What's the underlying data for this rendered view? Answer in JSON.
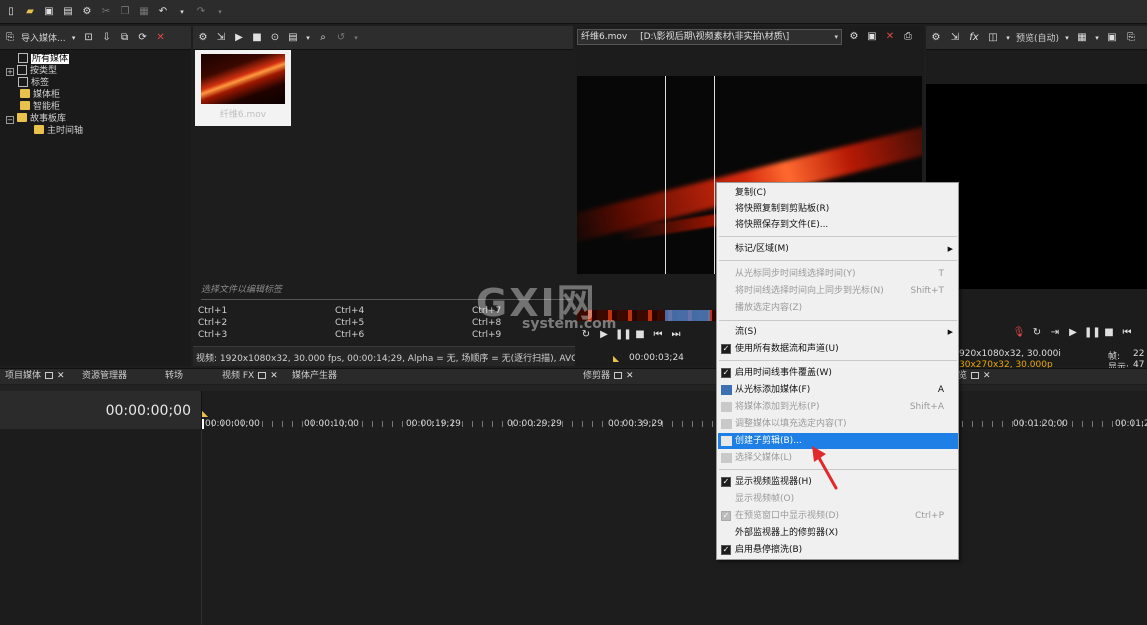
{
  "project_tree": {
    "items": [
      {
        "label": "所有媒体"
      },
      {
        "label": "按类型"
      },
      {
        "label": "标签"
      },
      {
        "label": "媒体柜"
      },
      {
        "label": "智能柜"
      },
      {
        "label": "故事板库"
      },
      {
        "label": "主时间轴"
      }
    ]
  },
  "media_toolbar": {
    "import_label": "导入媒体..."
  },
  "media": {
    "thumb_label": "纤维6.mov",
    "tag_hint": "选择文件以编辑标签",
    "shortcuts": [
      "Ctrl+1",
      "Ctrl+2",
      "Ctrl+3",
      "Ctrl+4",
      "Ctrl+5",
      "Ctrl+6",
      "Ctrl+7",
      "Ctrl+8",
      "Ctrl+9"
    ],
    "info": "视频: 1920x1080x32, 30.000 fps, 00:00:14;29, Alpha = 无, 场顺序 = 无(逐行扫描), AVC"
  },
  "trimmer": {
    "file": "纤维6.mov",
    "path": "[D:\\影视后期\\视频素材\\非实拍\\材质\\]",
    "timecode": "00:00:03;24"
  },
  "preview": {
    "mode": "预览(自动)",
    "info1": "920x1080x32, 30.000i",
    "info2": "30x270x32, 30.000p",
    "frame_label": "帧:",
    "frame_value": "22",
    "display_label": "显示:",
    "display_value": "47"
  },
  "tabs": {
    "project_media": "项目媒体",
    "explorer": "资源管理器",
    "transitions": "转场",
    "video_fx": "视频 FX",
    "media_generators": "媒体产生器",
    "trimmer": "修剪器",
    "preview": "览"
  },
  "timeline": {
    "timecode": "00:00:00;00",
    "ruler": [
      "00:00:00;00",
      "00:00:10;00",
      "00:00:19;29",
      "00:00:29;29",
      "00:00:39;29",
      "00:01:20;00",
      "00:01:2"
    ]
  },
  "watermark": {
    "brand": "GXI网",
    "site": "system.com"
  },
  "context_menu": {
    "items": [
      {
        "label": "复制(C)",
        "state": "normal"
      },
      {
        "label": "将快照复制到剪贴板(R)",
        "state": "normal"
      },
      {
        "label": "将快照保存到文件(E)...",
        "state": "normal"
      },
      {
        "label": "标记/区域(M)",
        "state": "normal",
        "submenu": true
      },
      {
        "label": "从光标同步时间线选择时间(Y)",
        "state": "disabled",
        "shortcut": "T"
      },
      {
        "label": "将时间线选择时间向上同步到光标(N)",
        "state": "disabled",
        "shortcut": "Shift+T"
      },
      {
        "label": "播放选定内容(Z)",
        "state": "disabled"
      },
      {
        "label": "流(S)",
        "state": "normal",
        "submenu": true
      },
      {
        "label": "使用所有数据流和声道(U)",
        "state": "normal",
        "checked": true
      },
      {
        "label": "启用时间线事件覆盖(W)",
        "state": "normal",
        "checked": true
      },
      {
        "label": "从光标添加媒体(F)",
        "state": "normal",
        "icon": true,
        "shortcut": "A"
      },
      {
        "label": "将媒体添加到光标(P)",
        "state": "disabled",
        "icon": true,
        "shortcut": "Shift+A"
      },
      {
        "label": "调整媒体以填充选定内容(T)",
        "state": "disabled",
        "icon": true
      },
      {
        "label": "创建子剪辑(B)...",
        "state": "active",
        "icon": true
      },
      {
        "label": "选择父媒体(L)",
        "state": "disabled",
        "icon": true
      },
      {
        "label": "显示视频监视器(H)",
        "state": "normal",
        "checked": true
      },
      {
        "label": "显示视频帧(O)",
        "state": "disabled"
      },
      {
        "label": "在预览窗口中显示视频(D)",
        "state": "disabled",
        "checked": true,
        "shortcut": "Ctrl+P"
      },
      {
        "label": "外部监视器上的修剪器(X)",
        "state": "normal"
      },
      {
        "label": "启用悬停擦洗(B)",
        "state": "normal",
        "checked": true
      }
    ]
  },
  "colors": {
    "accent": "#1e80e6",
    "background": "#1e1e1e",
    "arrow": "#e0282d"
  }
}
